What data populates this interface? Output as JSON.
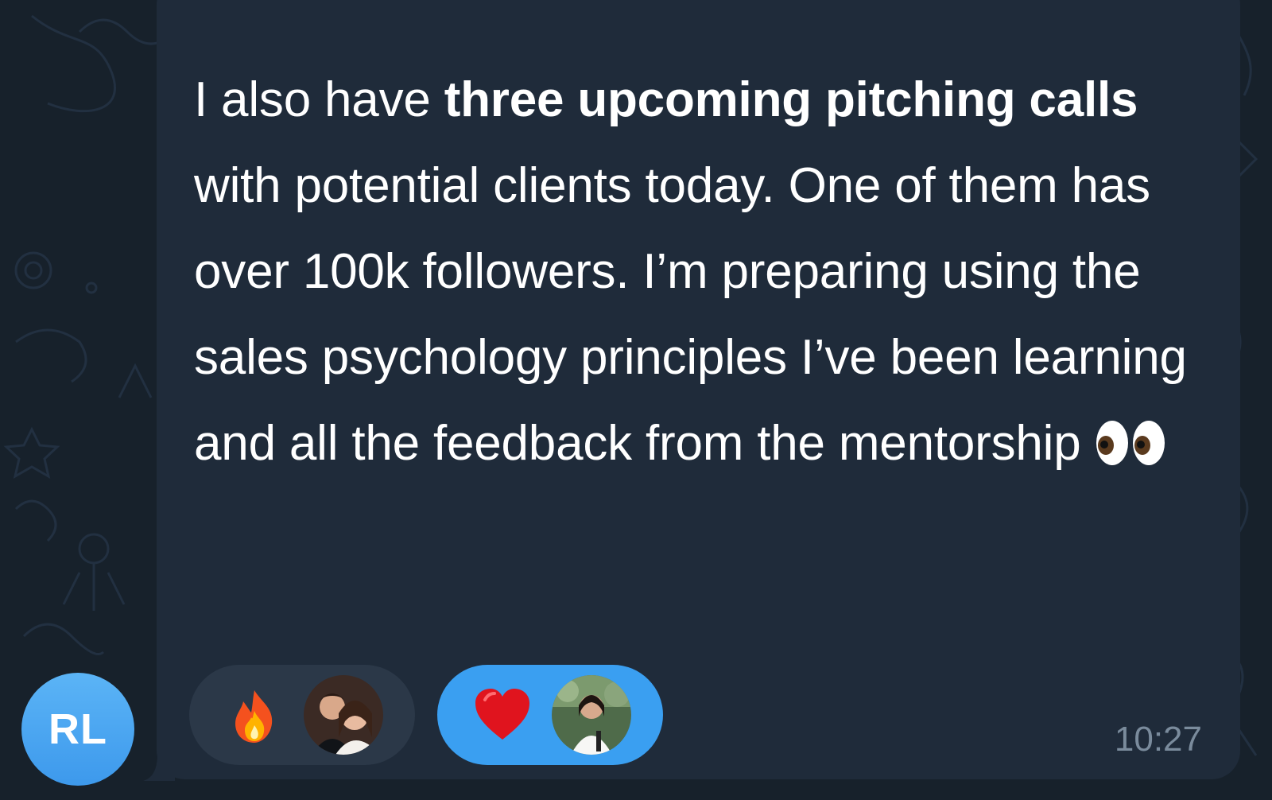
{
  "message": {
    "parts": [
      {
        "text": "I also have ",
        "bold": false
      },
      {
        "text": "three upcoming pitching calls",
        "bold": true
      },
      {
        "text": " with potential clients today. One of them has over 100k followers. I’m preparing using the sales psychology principles I’ve been learning and all the feedback from the mentorship ",
        "bold": false
      },
      {
        "text": "👀",
        "bold": false
      }
    ],
    "timestamp": "10:27"
  },
  "reactions": [
    {
      "emoji": "fire-icon",
      "count_avatars": 1,
      "style": "default"
    },
    {
      "emoji": "heart-icon",
      "count_avatars": 1,
      "style": "chosen"
    }
  ],
  "sender": {
    "initials": "RL"
  },
  "colors": {
    "background": "#17212b",
    "bubble": "#1f2b3a",
    "reaction_default": "#2b3848",
    "reaction_chosen": "#3a9ff1",
    "avatar": "#4aa6f0",
    "timestamp": "#7a8b9c"
  }
}
